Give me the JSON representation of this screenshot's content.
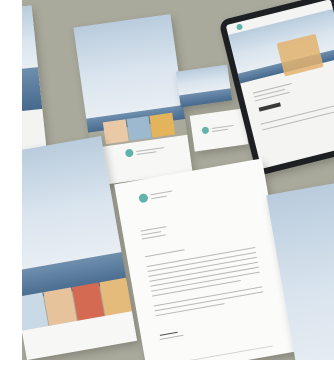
{
  "scene": {
    "background_color": "#a9a99c",
    "accent_color": "#5fb3a8"
  }
}
